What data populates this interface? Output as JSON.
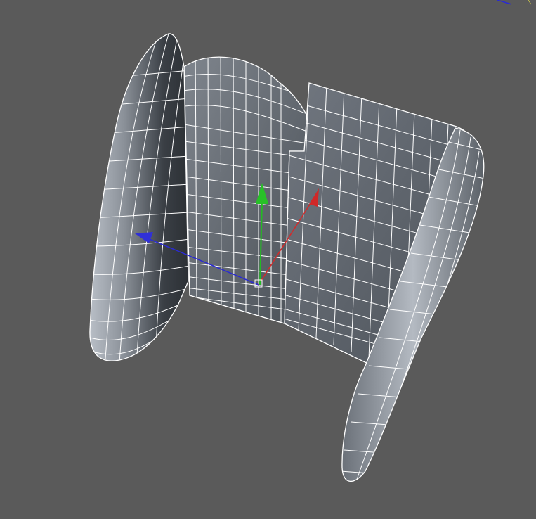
{
  "viewport": {
    "background": "#5a5a5a",
    "object": {
      "icon": "wireframe-chair-mesh",
      "shading": "smooth-gray",
      "wireframe_color": "#ffffff"
    },
    "gizmo": {
      "icon": "transform-axis-gizmo",
      "axes": [
        {
          "name": "x-axis",
          "color": "#d42a2a"
        },
        {
          "name": "y-axis",
          "color": "#22bb22"
        },
        {
          "name": "z-axis",
          "color": "#2a2ad4"
        }
      ]
    },
    "corner_axis_indicator": {
      "icon": "axis-indicator-icon"
    }
  }
}
